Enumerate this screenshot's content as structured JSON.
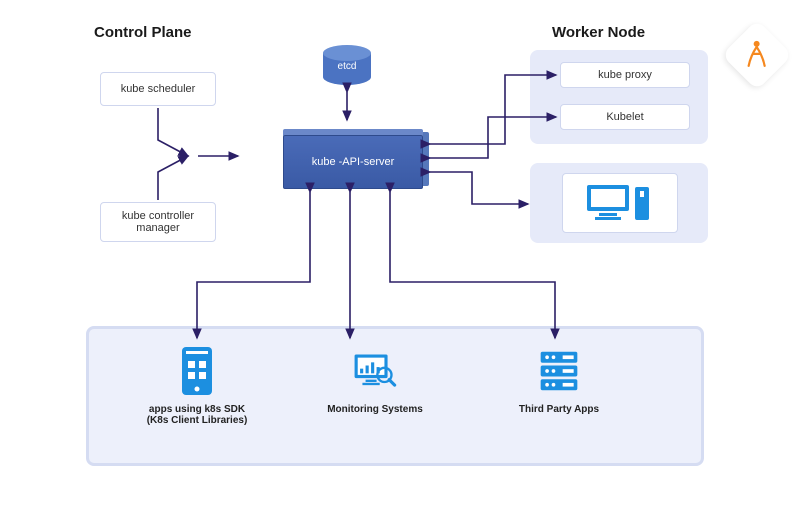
{
  "headings": {
    "control_plane": "Control Plane",
    "worker_node": "Worker Node"
  },
  "control_plane": {
    "scheduler": "kube scheduler",
    "controller_manager": "kube controller manager"
  },
  "center": {
    "etcd": "etcd",
    "api_server": "kube -API-server"
  },
  "worker": {
    "kube_proxy": "kube proxy",
    "kubelet": "Kubelet"
  },
  "bottom": {
    "apps_sdk_line1": "apps using k8s SDK",
    "apps_sdk_line2": "(K8s Client Libraries)",
    "monitoring": "Monitoring Systems",
    "third_party": "Third Party Apps"
  },
  "colors": {
    "panel": "#e6eaf9",
    "arrow": "#2b1f66",
    "icon": "#1c8fe0",
    "api": "#4a6bb8"
  }
}
